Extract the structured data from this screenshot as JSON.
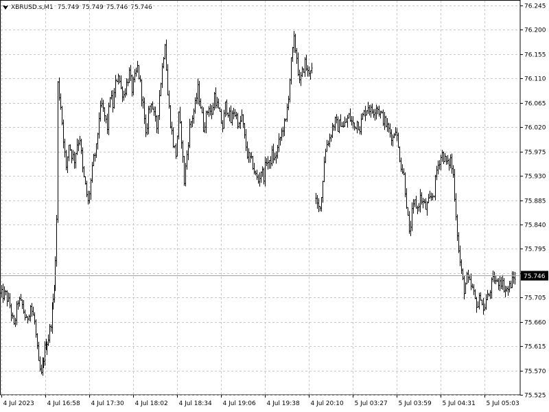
{
  "header": {
    "symbol": "XBRUSD.s,M1",
    "open": "75.749",
    "high": "75.749",
    "low": "75.746",
    "close": "75.746"
  },
  "colors": {
    "background": "#ffffff",
    "grid": "#c8c8c8",
    "bars": "#000000",
    "price_label_bg": "#000000",
    "price_label_fg": "#ffffff"
  },
  "chart_data": {
    "type": "ohlc",
    "title": "XBRUSD.s,M1",
    "xlabel": "",
    "ylabel": "",
    "ylim": [
      75.525,
      76.245
    ],
    "grid": true,
    "y_ticks": [
      "76.245",
      "76.200",
      "76.155",
      "76.110",
      "76.065",
      "76.020",
      "75.975",
      "75.930",
      "75.885",
      "75.840",
      "75.795",
      "75.750",
      "75.705",
      "75.660",
      "75.615",
      "75.570",
      "75.525"
    ],
    "x_ticks": [
      "4 Jul 2023",
      "4 Jul 16:58",
      "4 Jul 17:30",
      "4 Jul 18:02",
      "4 Jul 18:34",
      "4 Jul 19:06",
      "4 Jul 19:38",
      "4 Jul 20:10",
      "5 Jul 03:27",
      "5 Jul 03:59",
      "5 Jul 04:31",
      "5 Jul 05:03"
    ],
    "current_price": "75.746",
    "segments": [
      {
        "name": "segment-1",
        "points": [
          [
            0,
            75.71
          ],
          [
            8,
            75.71
          ],
          [
            14,
            75.69
          ],
          [
            20,
            75.65
          ],
          [
            26,
            75.7
          ],
          [
            32,
            75.69
          ],
          [
            38,
            75.66
          ],
          [
            44,
            75.69
          ],
          [
            50,
            75.66
          ],
          [
            56,
            75.58
          ],
          [
            60,
            75.56
          ],
          [
            65,
            75.61
          ],
          [
            70,
            75.63
          ],
          [
            74,
            75.66
          ],
          [
            77,
            75.7
          ],
          [
            80,
            75.77
          ],
          [
            82,
            75.85
          ],
          [
            84,
            76.1
          ],
          [
            88,
            76.06
          ],
          [
            92,
            76.0
          ],
          [
            96,
            75.94
          ],
          [
            100,
            75.99
          ],
          [
            104,
            75.97
          ],
          [
            108,
            75.96
          ],
          [
            112,
            75.99
          ],
          [
            116,
            76.0
          ],
          [
            120,
            75.94
          ],
          [
            124,
            75.91
          ],
          [
            128,
            75.88
          ],
          [
            132,
            75.92
          ],
          [
            136,
            75.96
          ],
          [
            140,
            75.98
          ],
          [
            144,
            76.04
          ],
          [
            148,
            76.06
          ],
          [
            152,
            76.04
          ],
          [
            156,
            76.02
          ],
          [
            160,
            76.08
          ],
          [
            164,
            76.06
          ],
          [
            168,
            76.1
          ],
          [
            172,
            76.12
          ],
          [
            176,
            76.09
          ],
          [
            180,
            76.08
          ],
          [
            184,
            76.1
          ],
          [
            188,
            76.12
          ],
          [
            192,
            76.09
          ],
          [
            196,
            76.11
          ],
          [
            200,
            76.13
          ],
          [
            204,
            76.1
          ],
          [
            208,
            76.06
          ],
          [
            212,
            76.0
          ],
          [
            216,
            76.05
          ],
          [
            220,
            76.07
          ],
          [
            224,
            76.04
          ],
          [
            228,
            76.02
          ],
          [
            232,
            76.08
          ],
          [
            236,
            76.13
          ],
          [
            240,
            76.18
          ],
          [
            244,
            76.08
          ],
          [
            248,
            76.03
          ],
          [
            252,
            75.99
          ],
          [
            256,
            75.97
          ],
          [
            260,
            76.04
          ],
          [
            264,
            76.0
          ],
          [
            268,
            75.92
          ],
          [
            272,
            75.97
          ],
          [
            276,
            76.02
          ],
          [
            280,
            76.04
          ],
          [
            284,
            76.06
          ],
          [
            288,
            76.09
          ],
          [
            292,
            76.06
          ],
          [
            296,
            76.02
          ],
          [
            300,
            76.04
          ],
          [
            304,
            76.06
          ],
          [
            308,
            76.04
          ],
          [
            312,
            76.08
          ],
          [
            316,
            76.06
          ],
          [
            320,
            76.04
          ],
          [
            324,
            76.02
          ],
          [
            328,
            76.06
          ],
          [
            332,
            76.05
          ],
          [
            336,
            76.03
          ],
          [
            340,
            76.05
          ],
          [
            344,
            76.04
          ],
          [
            348,
            76.02
          ],
          [
            352,
            76.04
          ],
          [
            356,
            76.0
          ],
          [
            360,
            75.97
          ],
          [
            364,
            75.96
          ],
          [
            368,
            75.95
          ],
          [
            372,
            75.93
          ],
          [
            376,
            75.92
          ],
          [
            380,
            75.94
          ],
          [
            384,
            75.93
          ],
          [
            388,
            75.96
          ],
          [
            392,
            75.95
          ],
          [
            396,
            75.97
          ],
          [
            400,
            75.96
          ],
          [
            404,
            75.98
          ],
          [
            408,
            76.0
          ],
          [
            412,
            76.02
          ],
          [
            416,
            76.03
          ],
          [
            420,
            76.08
          ],
          [
            424,
            76.14
          ],
          [
            428,
            76.18
          ],
          [
            432,
            76.15
          ],
          [
            436,
            76.1
          ],
          [
            440,
            76.12
          ],
          [
            444,
            76.14
          ],
          [
            448,
            76.12
          ],
          [
            452,
            76.13
          ],
          [
            456,
            76.12
          ]
        ]
      },
      {
        "name": "segment-2",
        "points": [
          [
            460,
            75.88
          ],
          [
            464,
            75.87
          ],
          [
            468,
            75.89
          ],
          [
            472,
            75.96
          ],
          [
            476,
            75.99
          ],
          [
            480,
            76.0
          ],
          [
            484,
            76.02
          ],
          [
            488,
            76.03
          ],
          [
            492,
            76.02
          ],
          [
            496,
            76.03
          ],
          [
            500,
            76.02
          ],
          [
            504,
            76.03
          ],
          [
            508,
            76.04
          ],
          [
            512,
            76.03
          ],
          [
            516,
            76.02
          ],
          [
            520,
            76.03
          ],
          [
            524,
            76.02
          ],
          [
            528,
            76.04
          ],
          [
            532,
            76.05
          ],
          [
            536,
            76.06
          ],
          [
            540,
            76.05
          ],
          [
            544,
            76.05
          ],
          [
            548,
            76.06
          ],
          [
            552,
            76.05
          ],
          [
            556,
            76.04
          ],
          [
            560,
            76.03
          ],
          [
            564,
            76.02
          ],
          [
            568,
            76.01
          ],
          [
            572,
            76.0
          ],
          [
            576,
            76.02
          ],
          [
            580,
            75.98
          ],
          [
            584,
            75.95
          ],
          [
            588,
            75.93
          ],
          [
            592,
            75.88
          ],
          [
            596,
            75.82
          ],
          [
            600,
            75.86
          ],
          [
            604,
            75.88
          ],
          [
            608,
            75.87
          ],
          [
            612,
            75.89
          ],
          [
            616,
            75.88
          ],
          [
            620,
            75.87
          ],
          [
            624,
            75.88
          ],
          [
            628,
            75.89
          ],
          [
            632,
            75.9
          ],
          [
            636,
            75.94
          ],
          [
            640,
            75.96
          ],
          [
            644,
            75.97
          ],
          [
            648,
            75.96
          ],
          [
            652,
            75.95
          ],
          [
            656,
            75.96
          ],
          [
            660,
            75.93
          ],
          [
            664,
            75.86
          ],
          [
            668,
            75.79
          ],
          [
            672,
            75.75
          ],
          [
            676,
            75.72
          ],
          [
            680,
            75.74
          ],
          [
            684,
            75.73
          ],
          [
            688,
            75.72
          ],
          [
            692,
            75.7
          ],
          [
            696,
            75.69
          ],
          [
            700,
            75.71
          ],
          [
            704,
            75.68
          ],
          [
            708,
            75.7
          ],
          [
            712,
            75.71
          ],
          [
            716,
            75.73
          ],
          [
            720,
            75.74
          ],
          [
            724,
            75.73
          ],
          [
            728,
            75.74
          ],
          [
            732,
            75.73
          ],
          [
            736,
            75.72
          ],
          [
            740,
            75.72
          ],
          [
            744,
            75.73
          ],
          [
            748,
            75.74
          ],
          [
            752,
            75.746
          ]
        ]
      }
    ]
  }
}
